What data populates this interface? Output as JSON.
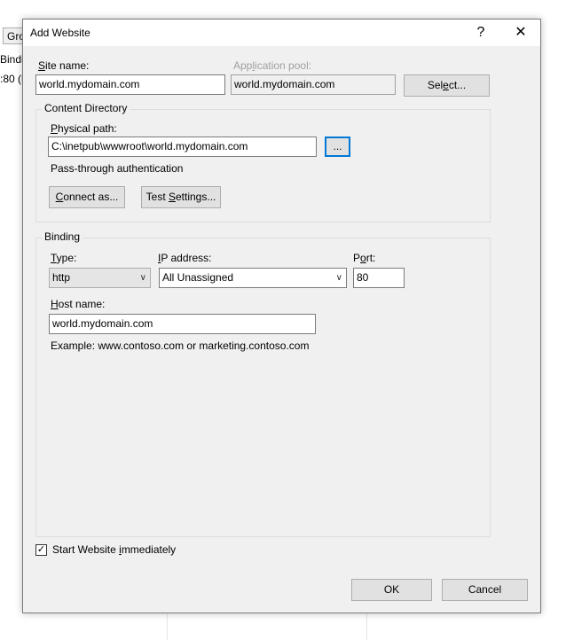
{
  "background": {
    "tab_label": "Gro",
    "line1": "Bindir",
    "line2": ":80 (h"
  },
  "dialog": {
    "title": "Add Website",
    "help_glyph": "?",
    "close_glyph": "✕"
  },
  "site": {
    "label_prefix": "",
    "label_u": "S",
    "label_rest": "ite name:",
    "value": "world.mydomain.com"
  },
  "app_pool": {
    "label_a": "App",
    "label_u": "l",
    "label_b": "ication pool:",
    "value": "world.mydomain.com",
    "select_a": "Sel",
    "select_u": "e",
    "select_b": "ct..."
  },
  "content_directory": {
    "title": "Content Directory",
    "path_label_u": "P",
    "path_label_rest": "hysical path:",
    "path_value": "C:\\inetpub\\wwwroot\\world.mydomain.com",
    "browse_label": "...",
    "pass_through": "Pass-through authentication",
    "connect_u": "C",
    "connect_rest": "onnect as...",
    "test_a": "Test ",
    "test_u": "S",
    "test_b": "ettings..."
  },
  "binding": {
    "title": "Binding",
    "type_label_u": "T",
    "type_label_rest": "ype:",
    "type_value": "http",
    "ip_label_u": "I",
    "ip_label_rest": "P address:",
    "ip_value": "All Unassigned",
    "port_label_a": "P",
    "port_label_u": "o",
    "port_label_b": "rt:",
    "port_value": "80",
    "host_label_u": "H",
    "host_label_rest": "ost name:",
    "host_value": "world.mydomain.com",
    "example": "Example: www.contoso.com or marketing.contoso.com"
  },
  "start": {
    "checked": true,
    "label_a": "Start Website ",
    "label_u": "i",
    "label_b": "mmediately"
  },
  "buttons": {
    "ok": "OK",
    "cancel": "Cancel"
  }
}
